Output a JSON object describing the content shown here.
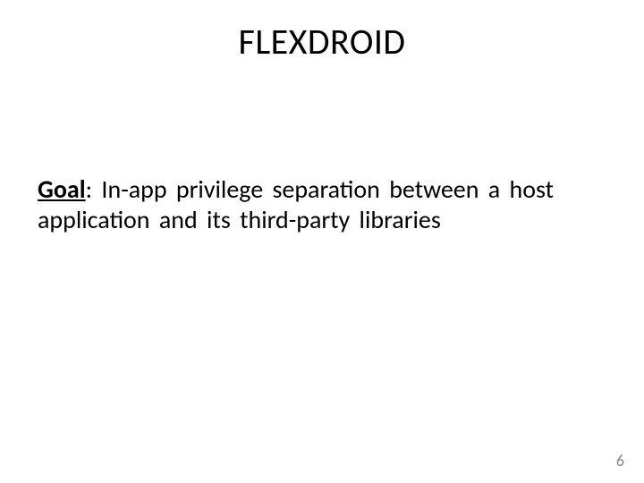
{
  "slide": {
    "title": "FLEXDROID",
    "goal_label": "Goal",
    "goal_colon": ": ",
    "goal_text": "In-app privilege separation between a host application and its third-party libraries",
    "page_number": "6"
  }
}
